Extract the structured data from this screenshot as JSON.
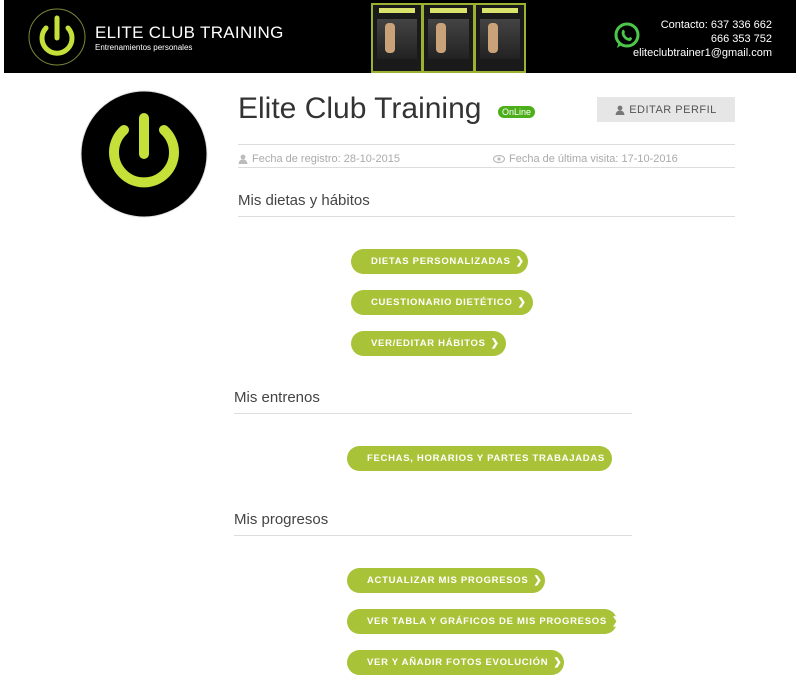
{
  "header": {
    "brand": "ELITE CLUB TRAINING",
    "tagline": "Entrenamientos personales",
    "contact_line1": "Contacto: 637 336 662",
    "contact_line2": "666 353 752",
    "contact_line3": "eliteclubtrainer1@gmail.com"
  },
  "profile": {
    "name": "Elite Club Training",
    "status": "OnLine",
    "edit_label": "EDITAR PERFIL",
    "registered": "Fecha de registro: 28-10-2015",
    "last_visit": "Fecha de última visita: 17-10-2016"
  },
  "sections": {
    "diets": {
      "title": "Mis dietas y hábitos",
      "buttons": [
        "DIETAS PERSONALIZADAS",
        "CUESTIONARIO DIETÉTICO",
        "VER/EDITAR HÁBITOS"
      ]
    },
    "trainings": {
      "title": "Mis entrenos",
      "buttons": [
        "FECHAS, HORARIOS Y PARTES TRABAJADAS"
      ]
    },
    "progress": {
      "title": "Mis progresos",
      "buttons": [
        "ACTUALIZAR MIS PROGRESOS",
        "VER TABLA Y GRÁFICOS DE MIS PROGRESOS",
        "VER Y AÑADIR FOTOS EVOLUCIÓN"
      ]
    }
  },
  "colors": {
    "accent": "#a8c337",
    "online": "#4caf1a",
    "header_bg": "#000000"
  },
  "icons": {
    "logo": "power-icon",
    "whatsapp": "whatsapp-icon",
    "user": "user-icon",
    "eye": "eye-icon",
    "chevron": "chevron-right-icon"
  }
}
